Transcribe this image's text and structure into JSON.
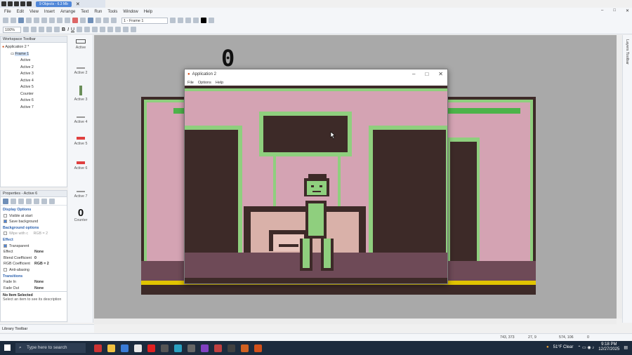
{
  "quick_access": {
    "label": "9 Objects - 6.3 Mb"
  },
  "menu": [
    "File",
    "Edit",
    "View",
    "Insert",
    "Arrange",
    "Text",
    "Run",
    "Tools",
    "Window",
    "Help"
  ],
  "toolbar": {
    "frame_select": "1 - Frame 1",
    "zoom": "100%"
  },
  "workspace_toolbar": {
    "title": "Workspace Toolbar",
    "tree": [
      "Application 2 *",
      "Frame 1",
      "Active",
      "Active 2",
      "Active 3",
      "Active 4",
      "Active 5",
      "Counter",
      "Active 6",
      "Active 7"
    ]
  },
  "object_bar": [
    "Active",
    "Active 2",
    "Active 3",
    "Active 4",
    "Active 5",
    "Active 6",
    "Active 7",
    "Counter"
  ],
  "counter_value": "0",
  "properties": {
    "title": "Properties - Active 6",
    "rows": [
      {
        "type": "sec",
        "label": "Display Options"
      },
      {
        "type": "check",
        "label": "Visible at start",
        "checked": false
      },
      {
        "type": "check",
        "label": "Save background",
        "checked": true
      },
      {
        "type": "sec",
        "label": "Background options"
      },
      {
        "type": "check",
        "label": "Wipe with c",
        "checked": false,
        "value": "RGB = 2"
      },
      {
        "type": "sec",
        "label": "Effect"
      },
      {
        "type": "check",
        "label": "Transparent",
        "checked": true
      },
      {
        "type": "kv",
        "label": "Effect",
        "value": "None"
      },
      {
        "type": "kv",
        "label": "Blend Coefficient",
        "value": "0"
      },
      {
        "type": "kv",
        "label": "RGB Coefficient",
        "value": "RGB = 2"
      },
      {
        "type": "check",
        "label": "Anti-aliasing",
        "checked": false
      },
      {
        "type": "sec",
        "label": "Transitions"
      },
      {
        "type": "kv",
        "label": "Fade In",
        "value": "None"
      },
      {
        "type": "kv",
        "label": "Fade Out",
        "value": "None"
      }
    ],
    "info_title": "No Item Selected",
    "info_text": "Select an item to see its description"
  },
  "library_toolbar": {
    "title": "Library Toolbar"
  },
  "layers_toolbar": {
    "title": "Layers Toolbar"
  },
  "status": {
    "coords": "743, 373",
    "frame": "27, 9",
    "size": "574, 106",
    "zero": "0"
  },
  "app_window": {
    "title": "Application 2",
    "menu": [
      "File",
      "Options",
      "Help"
    ]
  },
  "taskbar": {
    "search_placeholder": "Type here to search",
    "weather": "51°F  Clear",
    "time": "9:18 PM",
    "date": "12/27/2025"
  },
  "colors": {
    "wall": "#d4a3b3",
    "green": "#8fcf7e",
    "dark": "#3d2a28",
    "floor": "#6e4a57",
    "workspace": "#a9a9a9",
    "accent": "#2f64b0"
  }
}
